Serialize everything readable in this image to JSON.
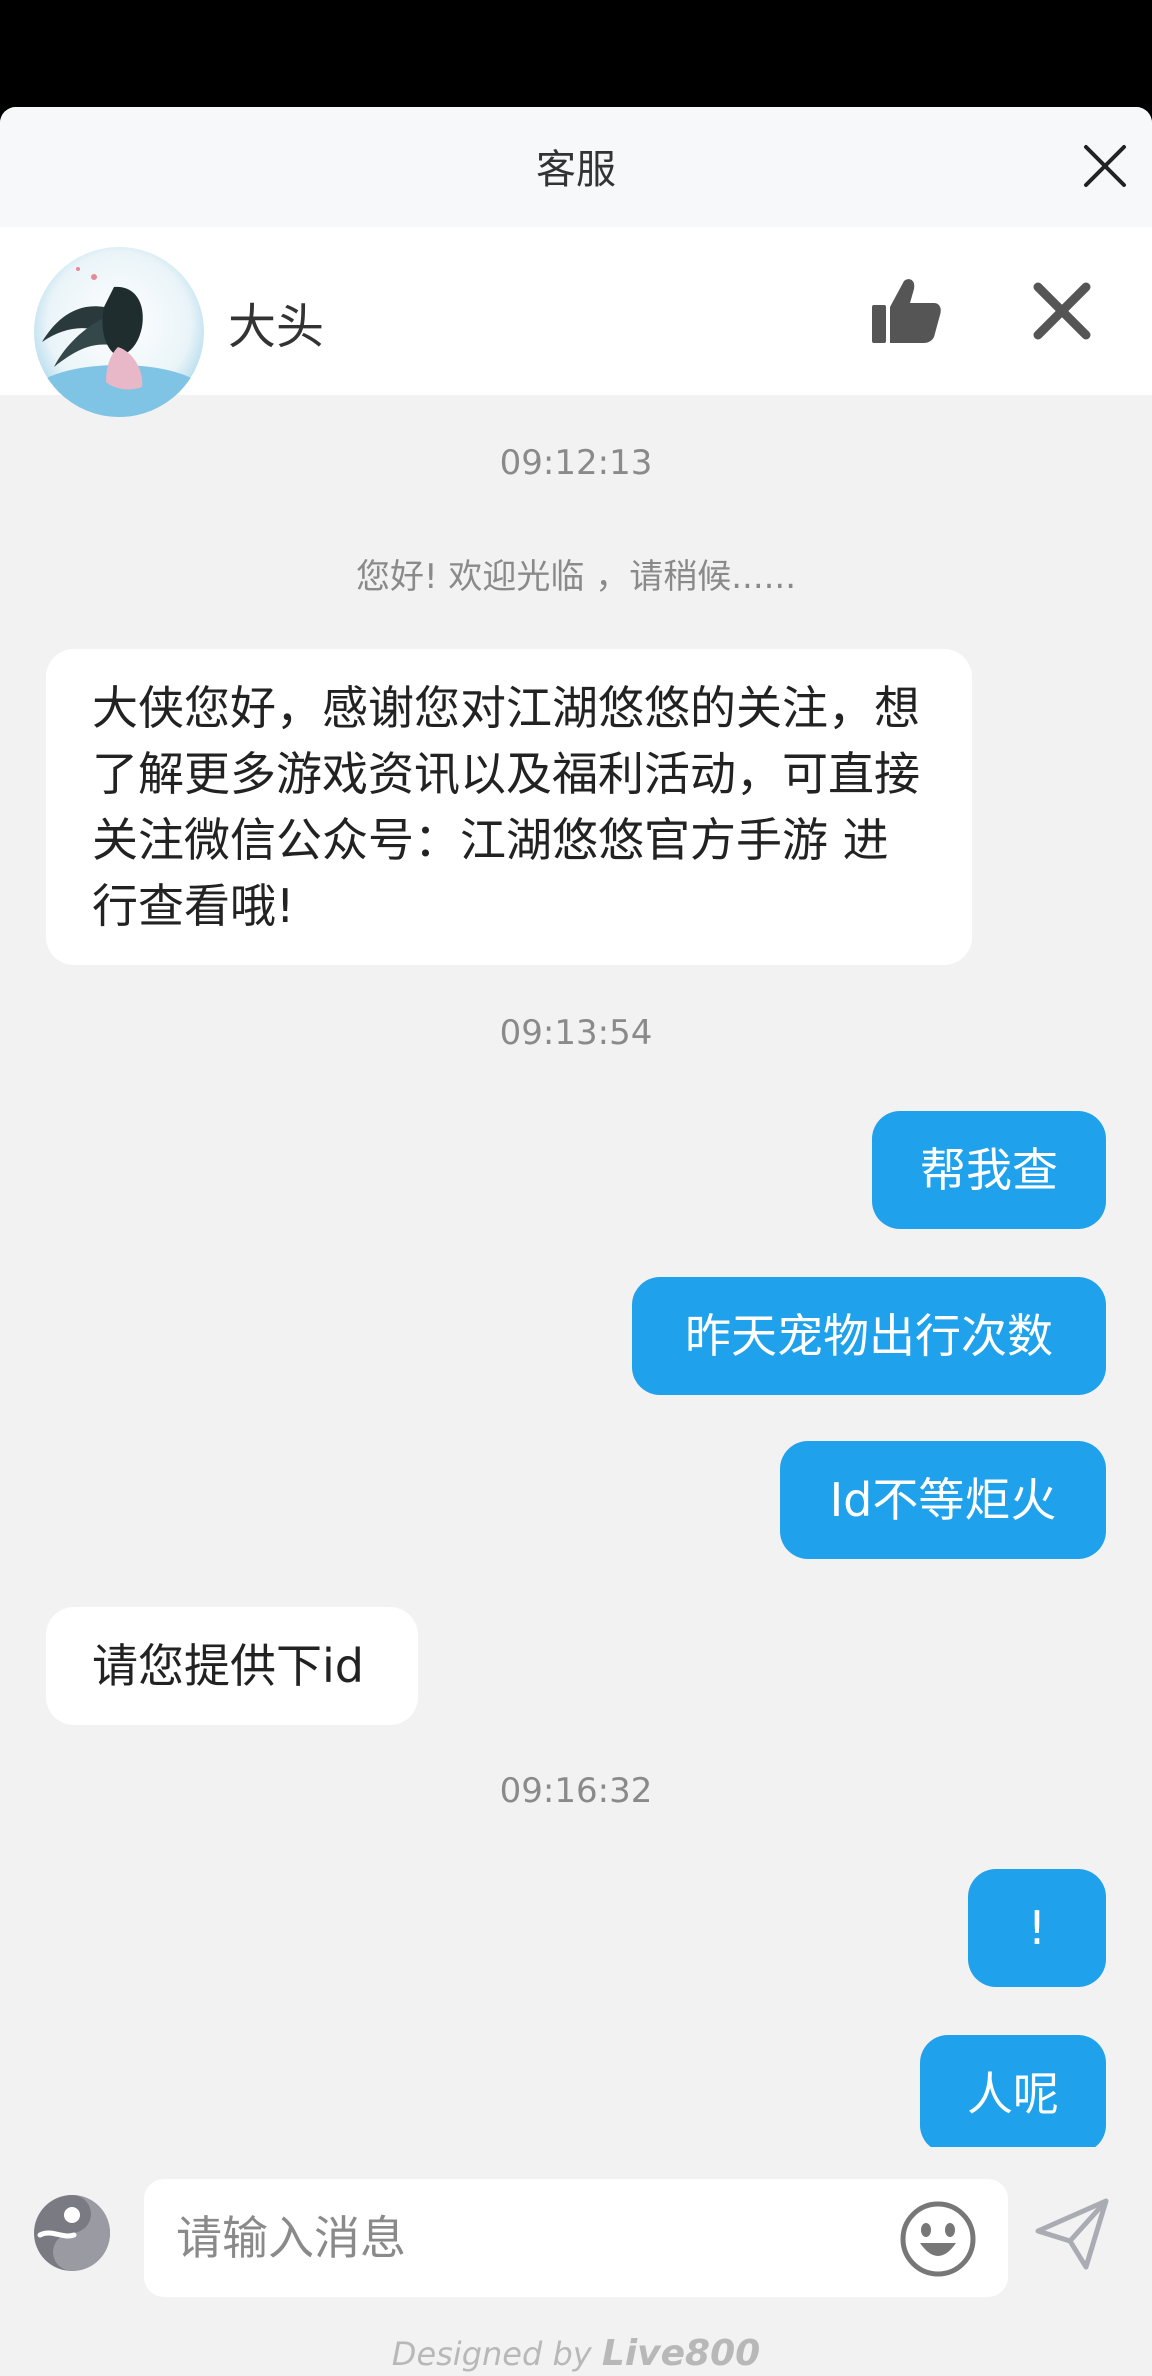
{
  "titlebar": {
    "title": "客服"
  },
  "agent": {
    "name": "大头"
  },
  "messages": {
    "ts1": "09:12:13",
    "system": "您好! 欢迎光临 ，请稍候......",
    "agent1": "大侠您好，感谢您对江湖悠悠的关注，想了解更多游戏资讯以及福利活动，可直接关注微信公众号：江湖悠悠官方手游 进行查看哦!",
    "ts2": "09:13:54",
    "user1": "帮我查",
    "user2": "昨天宠物出行次数",
    "user3": "Id不等炬火",
    "agent2": "请您提供下id",
    "ts3": "09:16:32",
    "user4": "!",
    "user5": "人呢"
  },
  "input": {
    "placeholder": "请输入消息"
  },
  "footer": {
    "designed_by": "Designed by",
    "brand": "Live800"
  },
  "colors": {
    "accent": "#1fa1ec",
    "background": "#f2f2f3"
  }
}
